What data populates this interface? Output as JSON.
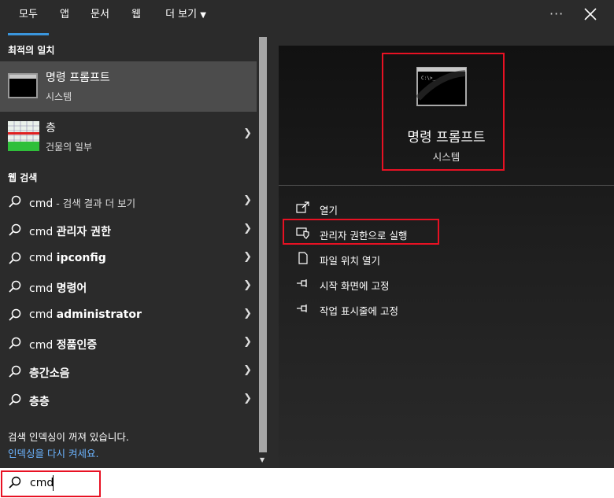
{
  "tabs": [
    {
      "label": "모두",
      "active": true
    },
    {
      "label": "앱"
    },
    {
      "label": "문서"
    },
    {
      "label": "웹"
    },
    {
      "label": "더 보기"
    }
  ],
  "header": {
    "more_label": "···"
  },
  "best_match": {
    "heading": "최적의 일치",
    "title": "명령 프롬프트",
    "subtitle": "시스템"
  },
  "second_item": {
    "title": "층",
    "subtitle": "건물의 일부"
  },
  "web_search": {
    "heading": "웹 검색",
    "rows": [
      {
        "prefix": "cmd",
        "bold": "",
        "suffix": " - 검색 결과 더 보기"
      },
      {
        "prefix": "cmd ",
        "bold": "관리자 권한",
        "suffix": ""
      },
      {
        "prefix": "cmd ",
        "bold": "ipconfig",
        "suffix": ""
      },
      {
        "prefix": "cmd ",
        "bold": "명령어",
        "suffix": ""
      },
      {
        "prefix": "cmd ",
        "bold": "administrator",
        "suffix": ""
      },
      {
        "prefix": "cmd ",
        "bold": "정품인증",
        "suffix": ""
      },
      {
        "prefix": "",
        "bold": "층간소음",
        "suffix": ""
      },
      {
        "prefix": "",
        "bold": "층층",
        "suffix": ""
      }
    ]
  },
  "index_notice": {
    "message": "검색 인덱싱이 꺼져 있습니다.",
    "link": "인덱싱을 다시 켜세요."
  },
  "detail": {
    "title": "명령 프롬프트",
    "subtitle": "시스템",
    "actions": [
      {
        "label": "열기",
        "icon": "open-icon"
      },
      {
        "label": "관리자 권한으로 실행",
        "icon": "shield-icon"
      },
      {
        "label": "파일 위치 열기",
        "icon": "file-icon"
      },
      {
        "label": "시작 화면에 고정",
        "icon": "pin-icon"
      },
      {
        "label": "작업 표시줄에 고정",
        "icon": "pin-icon"
      }
    ]
  },
  "search": {
    "value": "cmd"
  },
  "colors": {
    "accent": "#3a96dd",
    "highlight": "#e81123",
    "link": "#6cb4ff"
  }
}
